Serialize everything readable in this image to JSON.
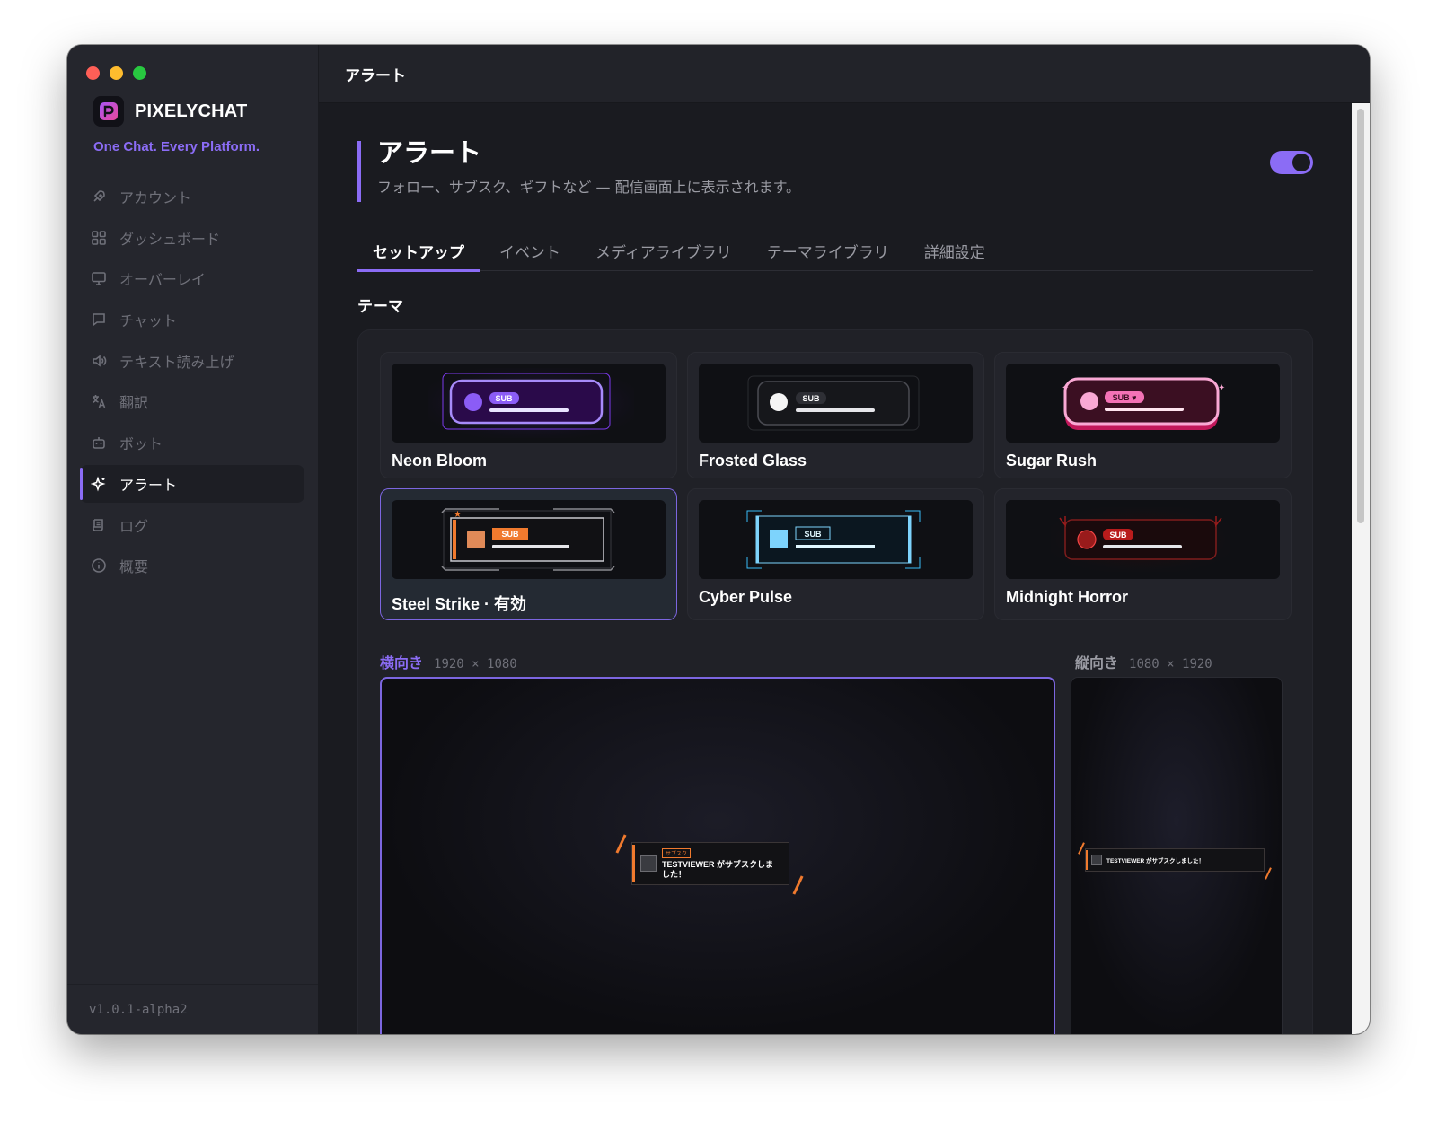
{
  "app": {
    "name": "PIXELYCHAT",
    "tagline": "One Chat. Every Platform.",
    "version": "v1.0.1-alpha2"
  },
  "sidebar": {
    "items": [
      {
        "label": "アカウント",
        "icon": "rocket-icon"
      },
      {
        "label": "ダッシュボード",
        "icon": "grid-icon"
      },
      {
        "label": "オーバーレイ",
        "icon": "monitor-icon"
      },
      {
        "label": "チャット",
        "icon": "chat-bubble-icon"
      },
      {
        "label": "テキスト読み上げ",
        "icon": "speaker-icon"
      },
      {
        "label": "翻訳",
        "icon": "translate-icon"
      },
      {
        "label": "ボット",
        "icon": "bot-icon"
      },
      {
        "label": "アラート",
        "icon": "sparkle-icon",
        "active": true
      },
      {
        "label": "ログ",
        "icon": "scroll-icon"
      },
      {
        "label": "概要",
        "icon": "info-icon"
      }
    ]
  },
  "topbar": {
    "title": "アラート"
  },
  "header": {
    "title": "アラート",
    "subtitle": "フォロー、サブスク、ギフトなど — 配信画面上に表示されます。",
    "enabled": true
  },
  "tabs": [
    {
      "label": "セットアップ",
      "active": true
    },
    {
      "label": "イベント"
    },
    {
      "label": "メディアライブラリ"
    },
    {
      "label": "テーマライブラリ"
    },
    {
      "label": "詳細設定"
    }
  ],
  "theme_section": {
    "label": "テーマ"
  },
  "themes": [
    {
      "name": "Neon Bloom",
      "tag": "SUB",
      "accent": "#8b5cf6"
    },
    {
      "name": "Frosted Glass",
      "tag": "SUB",
      "accent": "#ffffff"
    },
    {
      "name": "Sugar Rush",
      "tag": "SUB ♥",
      "accent": "#f472b6"
    },
    {
      "name": "Steel Strike · 有効",
      "tag": "SUB",
      "accent": "#f07a2e",
      "selected": true
    },
    {
      "name": "Cyber Pulse",
      "tag": "SUB",
      "accent": "#7dd3fc"
    },
    {
      "name": "Midnight Horror",
      "tag": "SUB",
      "accent": "#dc2626"
    }
  ],
  "preview": {
    "landscape": {
      "label": "横向き",
      "dims": "1920 × 1080"
    },
    "portrait": {
      "label": "縦向き",
      "dims": "1080 × 1920"
    },
    "alert_text": "TESTVIEWER がサブスクしました！",
    "alert_tag": "サブスク"
  },
  "colors": {
    "accent": "#8b6cf5",
    "steel_orange": "#f07a2e"
  }
}
